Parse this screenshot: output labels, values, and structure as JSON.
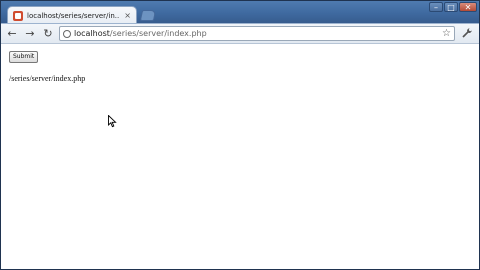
{
  "browser": {
    "tab": {
      "title": "localhost/series/server/in...",
      "close_glyph": "×"
    },
    "window_controls": {
      "minimize": "–",
      "maximize": "□",
      "close": "✕"
    },
    "toolbar": {
      "back_glyph": "←",
      "forward_glyph": "→",
      "reload_glyph": "↻",
      "url_host": "localhost",
      "url_path": "/series/server/index.php",
      "star_glyph": "☆",
      "wrench_glyph": "🔧"
    }
  },
  "page": {
    "submit_label": "Submit",
    "path_text": "/series/server/index.php"
  },
  "icons": {
    "favicon": "favicon-icon",
    "back": "back-arrow-icon",
    "forward": "forward-arrow-icon",
    "reload": "reload-icon",
    "page": "page-info-icon",
    "star": "bookmark-star-icon",
    "wrench": "wrench-icon",
    "cursor": "mouse-cursor-icon"
  }
}
